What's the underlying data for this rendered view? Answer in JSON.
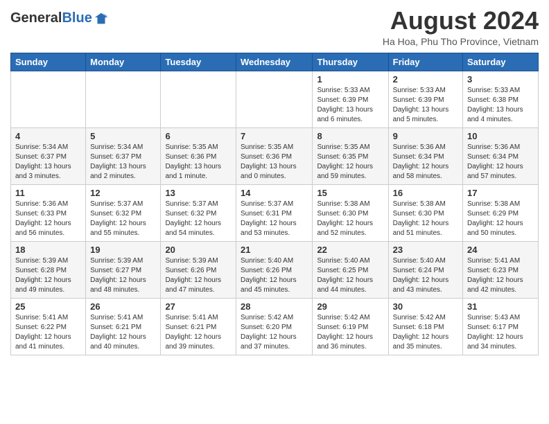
{
  "header": {
    "logo_general": "General",
    "logo_blue": "Blue",
    "month_title": "August 2024",
    "location": "Ha Hoa, Phu Tho Province, Vietnam"
  },
  "days_of_week": [
    "Sunday",
    "Monday",
    "Tuesday",
    "Wednesday",
    "Thursday",
    "Friday",
    "Saturday"
  ],
  "weeks": [
    [
      {
        "day": "",
        "info": ""
      },
      {
        "day": "",
        "info": ""
      },
      {
        "day": "",
        "info": ""
      },
      {
        "day": "",
        "info": ""
      },
      {
        "day": "1",
        "info": "Sunrise: 5:33 AM\nSunset: 6:39 PM\nDaylight: 13 hours\nand 6 minutes."
      },
      {
        "day": "2",
        "info": "Sunrise: 5:33 AM\nSunset: 6:39 PM\nDaylight: 13 hours\nand 5 minutes."
      },
      {
        "day": "3",
        "info": "Sunrise: 5:33 AM\nSunset: 6:38 PM\nDaylight: 13 hours\nand 4 minutes."
      }
    ],
    [
      {
        "day": "4",
        "info": "Sunrise: 5:34 AM\nSunset: 6:37 PM\nDaylight: 13 hours\nand 3 minutes."
      },
      {
        "day": "5",
        "info": "Sunrise: 5:34 AM\nSunset: 6:37 PM\nDaylight: 13 hours\nand 2 minutes."
      },
      {
        "day": "6",
        "info": "Sunrise: 5:35 AM\nSunset: 6:36 PM\nDaylight: 13 hours\nand 1 minute."
      },
      {
        "day": "7",
        "info": "Sunrise: 5:35 AM\nSunset: 6:36 PM\nDaylight: 13 hours\nand 0 minutes."
      },
      {
        "day": "8",
        "info": "Sunrise: 5:35 AM\nSunset: 6:35 PM\nDaylight: 12 hours\nand 59 minutes."
      },
      {
        "day": "9",
        "info": "Sunrise: 5:36 AM\nSunset: 6:34 PM\nDaylight: 12 hours\nand 58 minutes."
      },
      {
        "day": "10",
        "info": "Sunrise: 5:36 AM\nSunset: 6:34 PM\nDaylight: 12 hours\nand 57 minutes."
      }
    ],
    [
      {
        "day": "11",
        "info": "Sunrise: 5:36 AM\nSunset: 6:33 PM\nDaylight: 12 hours\nand 56 minutes."
      },
      {
        "day": "12",
        "info": "Sunrise: 5:37 AM\nSunset: 6:32 PM\nDaylight: 12 hours\nand 55 minutes."
      },
      {
        "day": "13",
        "info": "Sunrise: 5:37 AM\nSunset: 6:32 PM\nDaylight: 12 hours\nand 54 minutes."
      },
      {
        "day": "14",
        "info": "Sunrise: 5:37 AM\nSunset: 6:31 PM\nDaylight: 12 hours\nand 53 minutes."
      },
      {
        "day": "15",
        "info": "Sunrise: 5:38 AM\nSunset: 6:30 PM\nDaylight: 12 hours\nand 52 minutes."
      },
      {
        "day": "16",
        "info": "Sunrise: 5:38 AM\nSunset: 6:30 PM\nDaylight: 12 hours\nand 51 minutes."
      },
      {
        "day": "17",
        "info": "Sunrise: 5:38 AM\nSunset: 6:29 PM\nDaylight: 12 hours\nand 50 minutes."
      }
    ],
    [
      {
        "day": "18",
        "info": "Sunrise: 5:39 AM\nSunset: 6:28 PM\nDaylight: 12 hours\nand 49 minutes."
      },
      {
        "day": "19",
        "info": "Sunrise: 5:39 AM\nSunset: 6:27 PM\nDaylight: 12 hours\nand 48 minutes."
      },
      {
        "day": "20",
        "info": "Sunrise: 5:39 AM\nSunset: 6:26 PM\nDaylight: 12 hours\nand 47 minutes."
      },
      {
        "day": "21",
        "info": "Sunrise: 5:40 AM\nSunset: 6:26 PM\nDaylight: 12 hours\nand 45 minutes."
      },
      {
        "day": "22",
        "info": "Sunrise: 5:40 AM\nSunset: 6:25 PM\nDaylight: 12 hours\nand 44 minutes."
      },
      {
        "day": "23",
        "info": "Sunrise: 5:40 AM\nSunset: 6:24 PM\nDaylight: 12 hours\nand 43 minutes."
      },
      {
        "day": "24",
        "info": "Sunrise: 5:41 AM\nSunset: 6:23 PM\nDaylight: 12 hours\nand 42 minutes."
      }
    ],
    [
      {
        "day": "25",
        "info": "Sunrise: 5:41 AM\nSunset: 6:22 PM\nDaylight: 12 hours\nand 41 minutes."
      },
      {
        "day": "26",
        "info": "Sunrise: 5:41 AM\nSunset: 6:21 PM\nDaylight: 12 hours\nand 40 minutes."
      },
      {
        "day": "27",
        "info": "Sunrise: 5:41 AM\nSunset: 6:21 PM\nDaylight: 12 hours\nand 39 minutes."
      },
      {
        "day": "28",
        "info": "Sunrise: 5:42 AM\nSunset: 6:20 PM\nDaylight: 12 hours\nand 37 minutes."
      },
      {
        "day": "29",
        "info": "Sunrise: 5:42 AM\nSunset: 6:19 PM\nDaylight: 12 hours\nand 36 minutes."
      },
      {
        "day": "30",
        "info": "Sunrise: 5:42 AM\nSunset: 6:18 PM\nDaylight: 12 hours\nand 35 minutes."
      },
      {
        "day": "31",
        "info": "Sunrise: 5:43 AM\nSunset: 6:17 PM\nDaylight: 12 hours\nand 34 minutes."
      }
    ]
  ]
}
